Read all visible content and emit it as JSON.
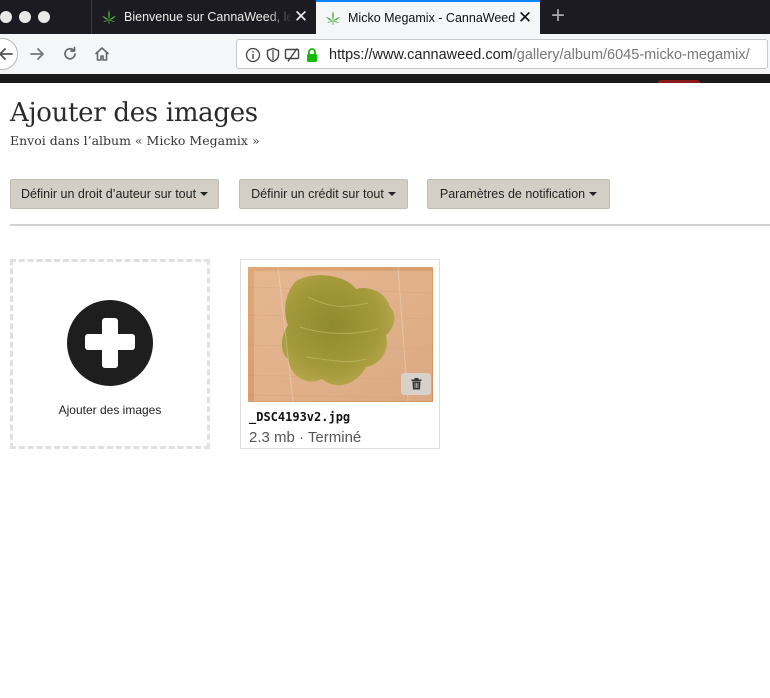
{
  "browser": {
    "tabs": [
      {
        "title": "Bienvenue sur CannaWeed, le s",
        "active": false
      },
      {
        "title": "Micko Megamix - CannaWeed",
        "active": true
      }
    ],
    "close_glyph": "✕",
    "new_tab_glyph": "+",
    "url": {
      "host": "https://www.cannaweed.com",
      "path": "/gallery/album/6045-micko-megamix/"
    },
    "accent_color": "#0a84ff"
  },
  "page": {
    "title": "Ajouter des images",
    "subtitle": "Envoi dans l’album « Micko Megamix »"
  },
  "actions": {
    "copyright_label": "Définir un droit d’auteur sur tout",
    "credit_label": "Définir un crédit sur tout",
    "notification_label": "Paramètres de notification"
  },
  "dropzone": {
    "label": "Ajouter des images"
  },
  "files": [
    {
      "name": "_DSC4193v2.jpg",
      "status": "2.3 mb · Terminé"
    }
  ],
  "icons": [
    "cannabis-leaf-icon",
    "back-arrow-icon",
    "forward-arrow-icon",
    "reload-icon",
    "home-icon",
    "info-icon",
    "shield-icon",
    "permissions-icon",
    "lock-icon",
    "plus-icon",
    "trash-icon"
  ]
}
